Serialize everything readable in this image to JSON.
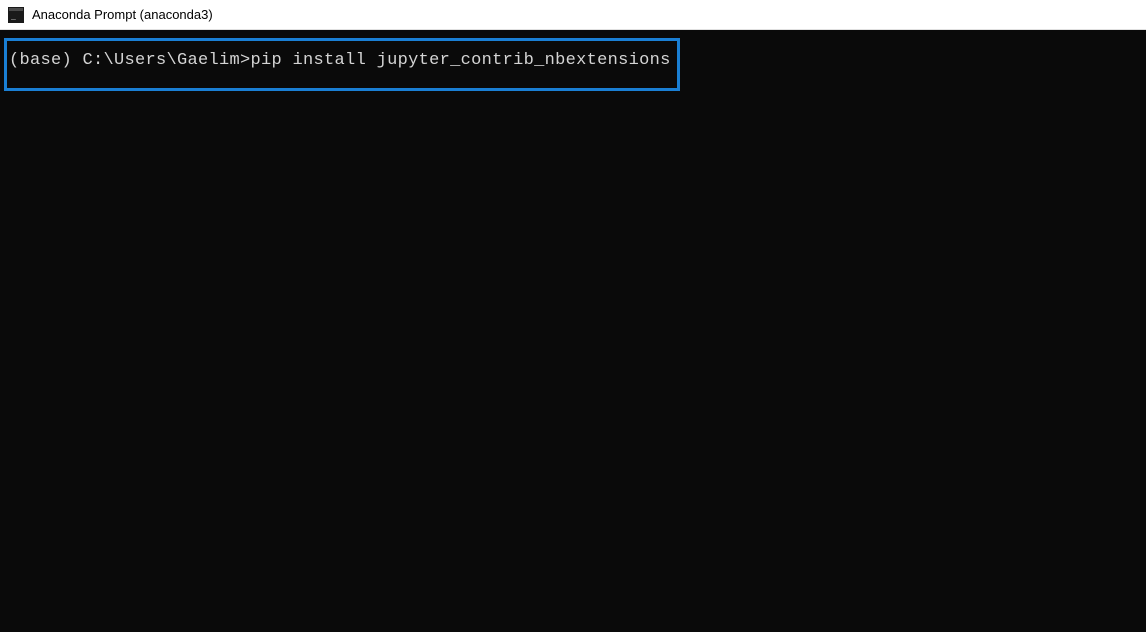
{
  "window": {
    "title": "Anaconda Prompt (anaconda3)"
  },
  "terminal": {
    "prompt": "(base) C:\\Users\\Gaelim>",
    "command": "pip install jupyter_contrib_nbextensions"
  },
  "colors": {
    "highlight_border": "#1a7fd4",
    "terminal_bg": "#0a0a0a",
    "terminal_fg": "#d4d4d4"
  }
}
